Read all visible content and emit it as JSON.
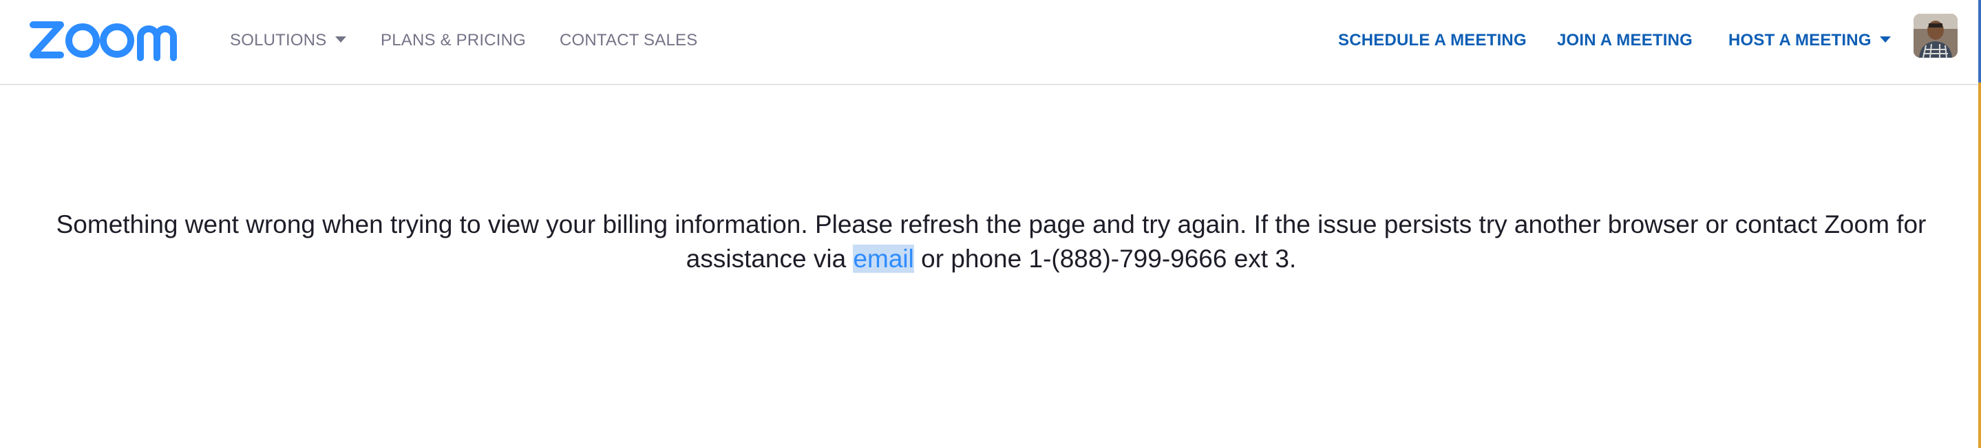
{
  "header": {
    "logo_text": "zoom",
    "nav_left": {
      "solutions": "SOLUTIONS",
      "plans_pricing": "PLANS & PRICING",
      "contact_sales": "CONTACT SALES"
    },
    "nav_right": {
      "schedule": "SCHEDULE A MEETING",
      "join": "JOIN A MEETING",
      "host": "HOST A MEETING"
    }
  },
  "error": {
    "text_before": "Something went wrong when trying to view your billing information. Please refresh the page and try again. If the issue persists try another browser or contact Zoom for assistance via ",
    "link_text": "email",
    "text_after": " or phone 1-(888)-799-9666 ext 3."
  },
  "colors": {
    "brand_blue": "#2d8cff",
    "nav_blue": "#0e5eb5",
    "nav_gray": "#747487"
  },
  "icons": {
    "solutions_caret": "caret-down-icon",
    "host_caret": "caret-down-icon"
  }
}
